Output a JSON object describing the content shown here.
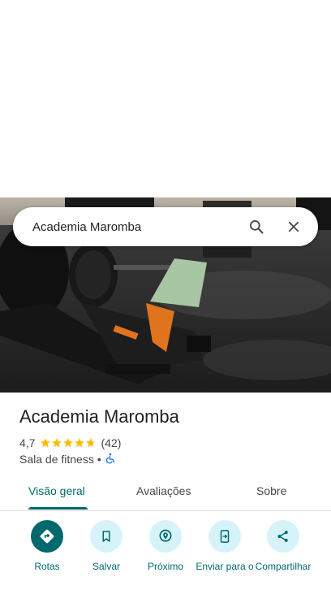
{
  "search": {
    "query": "Academia Maromba"
  },
  "place": {
    "name": "Academia Maromba",
    "rating": "4,7",
    "rating_value": 4.7,
    "rating_max": 5,
    "review_count": "(42)",
    "category": "Sala de fitness",
    "separator": "•"
  },
  "tabs": [
    {
      "label": "Visão geral",
      "active": true
    },
    {
      "label": "Avaliações",
      "active": false
    },
    {
      "label": "Sobre",
      "active": false
    }
  ],
  "actions": [
    {
      "label": "Rotas",
      "icon": "directions-icon"
    },
    {
      "label": "Salvar",
      "icon": "bookmark-icon"
    },
    {
      "label": "Próximo",
      "icon": "nearby-icon"
    },
    {
      "label": "Enviar para o",
      "icon": "send-to-phone-icon"
    },
    {
      "label": "Compartilhar",
      "icon": "share-icon"
    }
  ],
  "colors": {
    "accent": "#00696d",
    "accent_light": "#d6f3f9",
    "star": "#fbbc04",
    "accessibility": "#1a73e8"
  }
}
